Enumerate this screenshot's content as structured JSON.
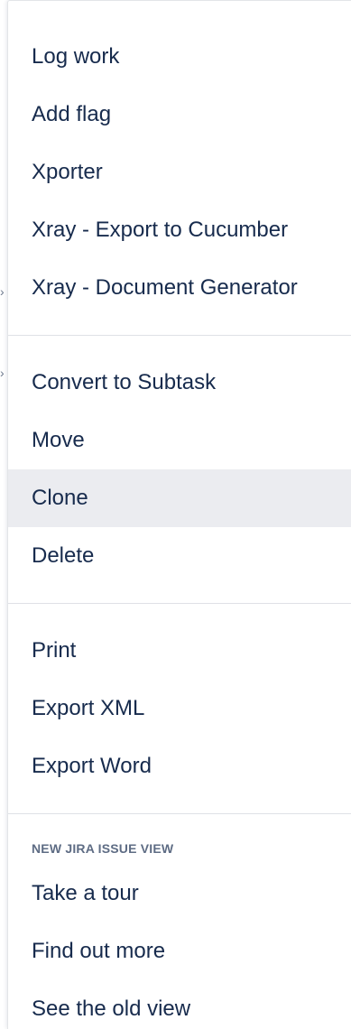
{
  "menu": {
    "group_work": [
      {
        "label": "Log work"
      },
      {
        "label": "Add flag"
      },
      {
        "label": "Xporter"
      },
      {
        "label": "Xray - Export to Cucumber"
      },
      {
        "label": "Xray - Document Generator"
      }
    ],
    "group_issue": [
      {
        "label": "Convert to Subtask"
      },
      {
        "label": "Move"
      },
      {
        "label": "Clone",
        "hovered": true
      },
      {
        "label": "Delete"
      }
    ],
    "group_export": [
      {
        "label": "Print"
      },
      {
        "label": "Export XML"
      },
      {
        "label": "Export Word"
      }
    ],
    "new_view": {
      "heading": "NEW JIRA ISSUE VIEW",
      "items": [
        {
          "label": "Take a tour"
        },
        {
          "label": "Find out more"
        },
        {
          "label": "See the old view"
        }
      ]
    }
  },
  "colors": {
    "text": "#172b4d",
    "heading": "#5e6c84",
    "hover_bg": "#ebecf0",
    "divider": "#dfe1e6"
  }
}
